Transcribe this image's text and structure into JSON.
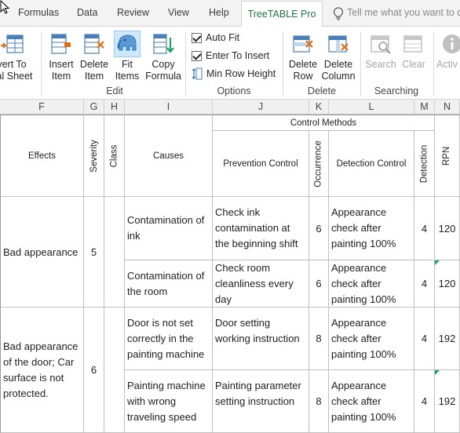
{
  "ribbon_tabs": [
    "Formulas",
    "Data",
    "Review",
    "View",
    "Help"
  ],
  "active_tab": "TreeTABLE Pro",
  "tell_me_placeholder": "Tell me what you want to do",
  "ribbon": {
    "convert_label_line1": "vert To",
    "convert_label_line2": "nal Sheet",
    "edit_buttons": [
      {
        "line1": "Insert",
        "line2": "Item"
      },
      {
        "line1": "Delete",
        "line2": "Item"
      },
      {
        "line1": "Fit",
        "line2": "Items"
      },
      {
        "line1": "Copy",
        "line2": "Formula"
      }
    ],
    "edit_group": "Edit",
    "options": {
      "auto_fit": "Auto Fit",
      "enter_to_insert": "Enter To Insert",
      "min_row_height": "Min Row Height"
    },
    "options_group": "Options",
    "delete_buttons": [
      {
        "line1": "Delete",
        "line2": "Row"
      },
      {
        "line1": "Delete",
        "line2": "Column"
      }
    ],
    "delete_group": "Delete",
    "search_label": "Search",
    "clear_label": "Clear",
    "searching_group": "Searching",
    "activate_label": "Activ"
  },
  "colors": {
    "accent": "#217346",
    "flag": "#21a366",
    "tab_bg": "#f3f3f3",
    "grid": "#bfbfbf"
  },
  "columns": [
    "F",
    "G",
    "H",
    "I",
    "J",
    "K",
    "L",
    "M",
    "N"
  ],
  "headers": {
    "effects": "Effects",
    "severity": "Severity",
    "class": "Class",
    "causes": "Causes",
    "control_methods": "Control Methods",
    "prevention": "Prevention Control",
    "occurrence": "Occurrence",
    "detection_control": "Detection Control",
    "detection": "Detection",
    "rpn": "RPN"
  },
  "groups": [
    {
      "effect": "Bad appearance",
      "severity": "5",
      "class": "",
      "rows": [
        {
          "cause": "Contamination of ink",
          "prevention": "Check ink contamination at the beginning shift",
          "occurrence": "6",
          "detection_control": "Appearance check after painting 100%",
          "detection": "4",
          "rpn": "120"
        },
        {
          "cause": "Contamination of the room",
          "prevention": "Check room cleanliness every day",
          "occurrence": "6",
          "detection_control": "Appearance check after painting 100%",
          "detection": "4",
          "rpn": "120"
        }
      ]
    },
    {
      "effect": "Bad appearance of the door; Car surface is not protected.",
      "severity": "6",
      "class": "",
      "rows": [
        {
          "cause": "Door is not set correctly in the painting machine",
          "prevention": "Door setting working instruction",
          "occurrence": "8",
          "detection_control": "Appearance check after painting 100%",
          "detection": "4",
          "rpn": "192"
        },
        {
          "cause": "Painting machine with wrong traveling speed",
          "prevention": "Painting parameter setting instruction",
          "occurrence": "8",
          "detection_control": "Appearance check after painting 100%",
          "detection": "4",
          "rpn": "192"
        }
      ]
    }
  ]
}
